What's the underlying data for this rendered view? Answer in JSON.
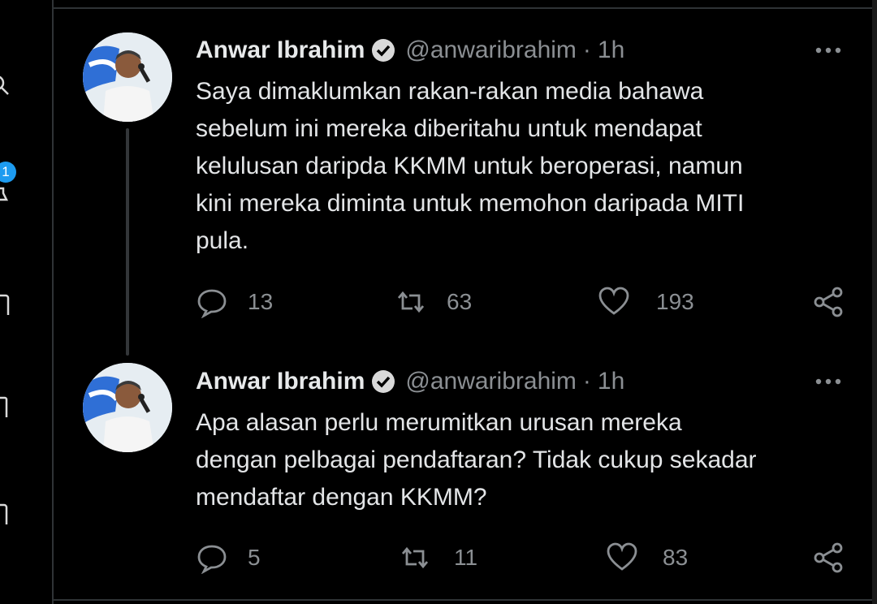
{
  "nav": {
    "notification_badge": "1",
    "icons": [
      "search-icon",
      "notifications-icon",
      "messages-icon",
      "bookmarks-icon",
      "lists-icon"
    ]
  },
  "tweets": [
    {
      "author_name": "Anwar Ibrahim",
      "handle": "@anwaribrahim",
      "separator": "·",
      "time": "1h",
      "text": "Saya dimaklumkan rakan-rakan media bahawa\nsebelum ini mereka diberitahu untuk mendapat\nkelulusan daripda KKMM untuk beroperasi, namun\nkini mereka diminta untuk memohon daripada MITI\npula.",
      "replies": "13",
      "retweets": "63",
      "likes": "193"
    },
    {
      "author_name": "Anwar Ibrahim",
      "handle": "@anwaribrahim",
      "separator": "·",
      "time": "1h",
      "text": "Apa alasan perlu merumitkan urusan mereka\ndengan pelbagai pendaftaran? Tidak cukup sekadar\nmendaftar dengan KKMM?",
      "replies": "5",
      "retweets": "11",
      "likes": "83"
    }
  ],
  "colors": {
    "background": "#000000",
    "accent": "#1d9bf0",
    "secondary_text": "#8b8f93",
    "divider": "#2f3336"
  }
}
